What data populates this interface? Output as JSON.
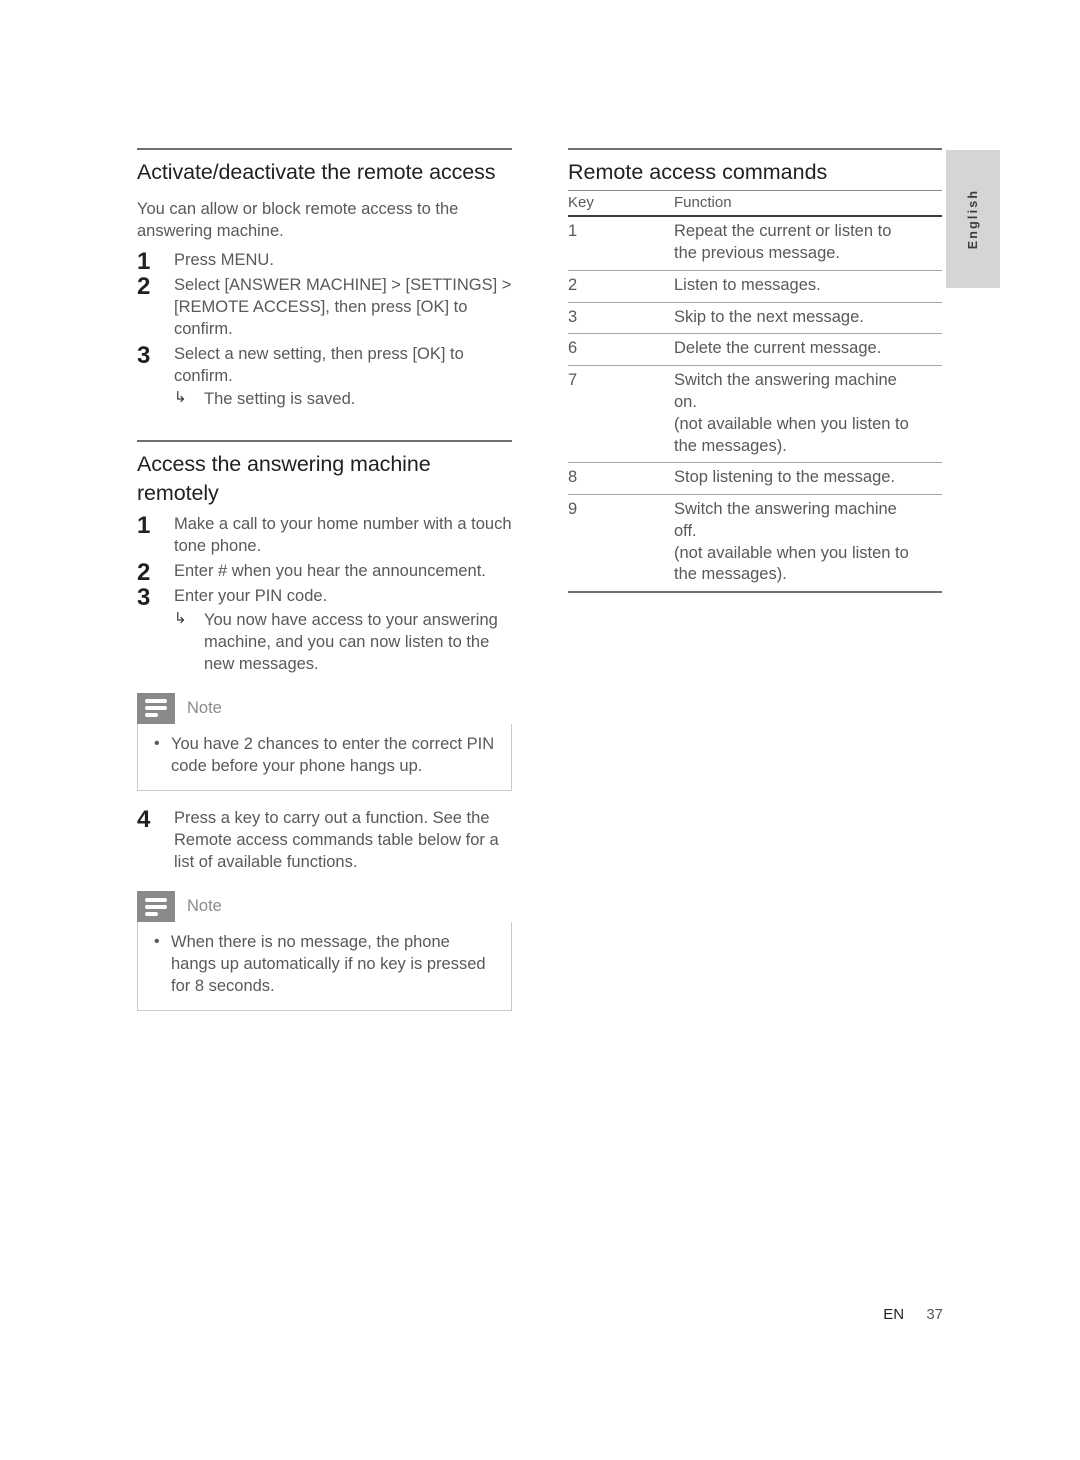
{
  "page": {
    "language_tab": "English",
    "footer": {
      "language_code": "EN",
      "page_number": "37"
    }
  },
  "left_column": {
    "section_1": {
      "title": "Activate/deactivate the remote access",
      "intro": "You can allow or block remote access to the answering machine.",
      "steps": [
        {
          "num": "1",
          "text": "Press MENU."
        },
        {
          "num": "2",
          "text": "Select [ANSWER MACHINE] > [SETTINGS] > [REMOTE ACCESS], then press [OK] to confirm."
        },
        {
          "num": "3",
          "text": "Select a new setting, then press [OK] to confirm.",
          "result": "The setting is saved."
        }
      ]
    },
    "section_2": {
      "title": "Access the answering machine remotely",
      "steps": [
        {
          "num": "1",
          "text": "Make a call to your home number with a touch tone phone."
        },
        {
          "num": "2",
          "text": "Enter # when you hear the announcement."
        },
        {
          "num": "3",
          "text": "Enter your PIN code.",
          "result": "You now have access to your answering machine, and you can now listen to the new messages."
        }
      ],
      "note_1": {
        "label": "Note",
        "items": [
          "You have 2 chances to enter the correct PIN code before your phone hangs up."
        ]
      },
      "step_4": {
        "num": "4",
        "text": "Press a key to carry out a function. See the Remote access commands table below for a list of available functions."
      },
      "note_2": {
        "label": "Note",
        "items": [
          "When there is no message, the phone hangs up automatically if no key is pressed for 8 seconds."
        ]
      }
    }
  },
  "right_column": {
    "table": {
      "title": "Remote access commands",
      "headers": {
        "key": "Key",
        "function": "Function"
      },
      "rows": [
        {
          "key": "1",
          "lines": [
            "Repeat the current or listen to",
            "the previous message."
          ]
        },
        {
          "key": "2",
          "lines": [
            "Listen to messages."
          ]
        },
        {
          "key": "3",
          "lines": [
            "Skip to the next message."
          ]
        },
        {
          "key": "6",
          "lines": [
            "Delete the current message."
          ]
        },
        {
          "key": "7",
          "lines": [
            "Switch the answering machine",
            "on.",
            "(not available when you listen to",
            "the messages)."
          ]
        },
        {
          "key": "8",
          "lines": [
            "Stop listening to the message."
          ]
        },
        {
          "key": "9",
          "lines": [
            "Switch the answering machine",
            "off.",
            "(not available when you listen to",
            "the messages)."
          ]
        }
      ]
    }
  },
  "icons": {
    "note_icon": "note-lines-icon"
  },
  "colors": {
    "heading": "#231f20",
    "body_text": "#58595b",
    "note_gray": "#8a8a8a",
    "lang_tab_bg": "#d4d5d7",
    "rule": "#6e6f71"
  }
}
